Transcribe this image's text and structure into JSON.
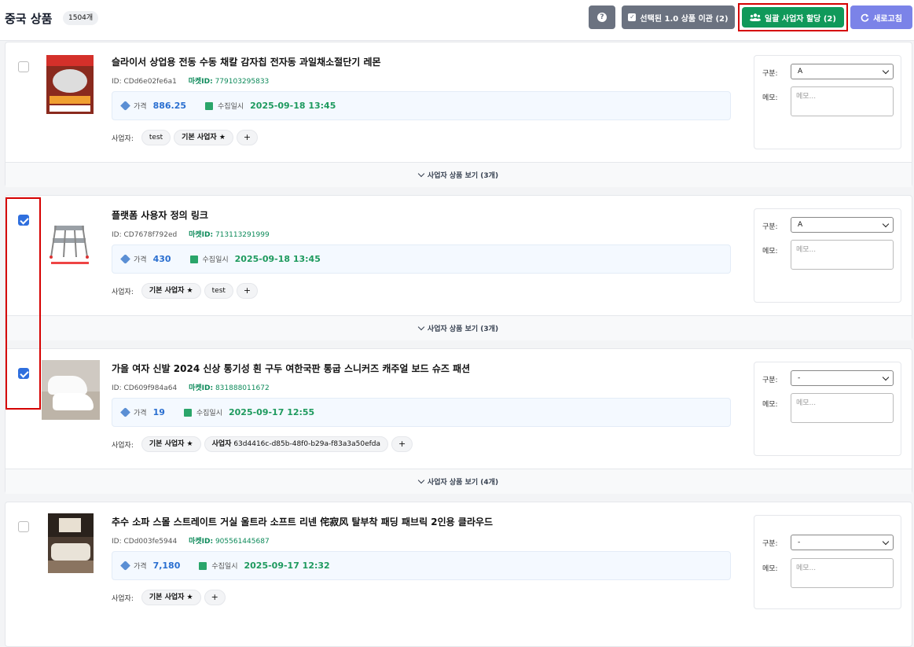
{
  "header": {
    "title": "중국 상품",
    "count": "1504개",
    "help_label": "?",
    "migrate_label": "선택된 1.0 상품 이관 (2)",
    "assign_label": "일괄 사업자 할당 (2)",
    "refresh_label": "새로고침"
  },
  "labels": {
    "id": "ID:",
    "market_id": "마켓ID:",
    "price": "가격",
    "collected_at": "수집일시",
    "business": "사업자:",
    "category": "구분:",
    "memo": "메모:",
    "memo_placeholder": "메모...",
    "add": "+"
  },
  "products": [
    {
      "checked": false,
      "name": "슬라이서 상업용 전동 수동 채칼 감자칩 전자동 과일채소절단기 레몬",
      "id": "CDd6e02fe6a1",
      "market_id": "779103295833",
      "price": "886.25",
      "date": "2025-09-18 13:45",
      "businesses": [
        {
          "label": "test",
          "bold": false
        },
        {
          "label": "기본 사업자 ★",
          "bold": true
        }
      ],
      "category": "A",
      "footer": "사업자 상품 보기 (3개)"
    },
    {
      "checked": true,
      "name": "플랫폼 사용자 정의 링크",
      "id": "CD7678f792ed",
      "market_id": "713113291999",
      "price": "430",
      "date": "2025-09-18 13:45",
      "businesses": [
        {
          "label": "기본 사업자 ★",
          "bold": true
        },
        {
          "label": "test",
          "bold": false
        }
      ],
      "category": "A",
      "footer": "사업자 상품 보기 (3개)"
    },
    {
      "checked": true,
      "name": "가을 여자 신발 2024 신상 통기성 흰 구두 여한국판 통굽 스니커즈 캐주얼 보드 슈즈 패션",
      "id": "CD609f984a64",
      "market_id": "831888011672",
      "price": "19",
      "date": "2025-09-17 12:55",
      "businesses": [
        {
          "label": "기본 사업자 ★",
          "bold": true
        },
        {
          "label": "사업자",
          "tail": " 63d4416c-d85b-48f0-b29a-f83a3a50efda",
          "bold": true
        }
      ],
      "category": "-",
      "footer": "사업자 상품 보기 (4개)"
    },
    {
      "checked": false,
      "name": "추수 소파 스몰 스트레이트 거실 울트라 소프트 리넨 侘寂风 탈부착 패딩 패브릭 2인용 클라우드",
      "id": "CDd003fe5944",
      "market_id": "905561445687",
      "price": "7,180",
      "date": "2025-09-17 12:32",
      "businesses": [
        {
          "label": "기본 사업자 ★",
          "bold": true
        }
      ],
      "category": "-",
      "footer": ""
    }
  ]
}
